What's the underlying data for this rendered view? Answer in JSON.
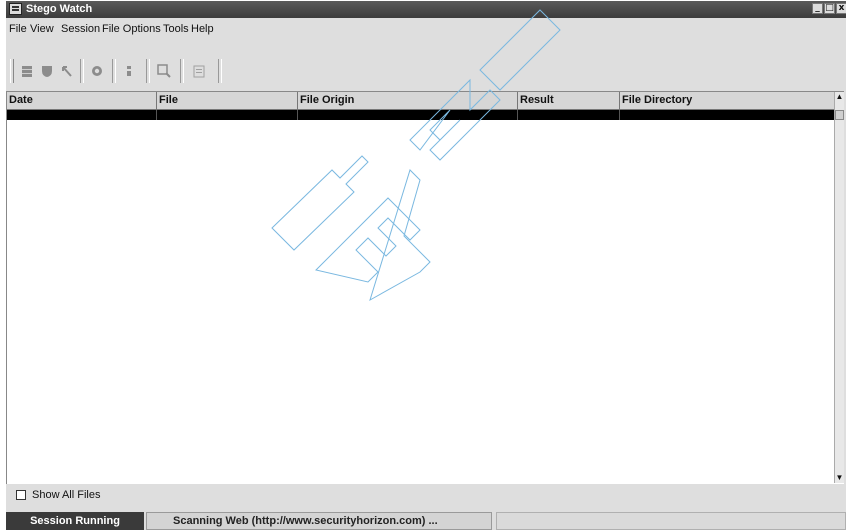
{
  "window": {
    "title": "Stego Watch"
  },
  "window_controls": {
    "minimize": "_",
    "maximize": "□",
    "close": "x"
  },
  "menu": [
    "File",
    "View",
    "Session",
    "File Options",
    "Tools",
    "Help"
  ],
  "toolbar": {
    "icons": [
      "stop-icon",
      "shield-icon",
      "wand-icon",
      "record-icon",
      "info-icon",
      "search-icon",
      "document-icon"
    ]
  },
  "table": {
    "columns": [
      "Date",
      "File",
      "File Origin",
      "Result",
      "File Directory"
    ],
    "rows": []
  },
  "options": {
    "show_all_files_label": "Show All Files",
    "show_all_files_checked": false
  },
  "status": {
    "session": "Session Running",
    "message": "Scanning Web (http://www.securityhorizon.com) ..."
  },
  "watermark": {
    "text": "TEAM FLY"
  }
}
